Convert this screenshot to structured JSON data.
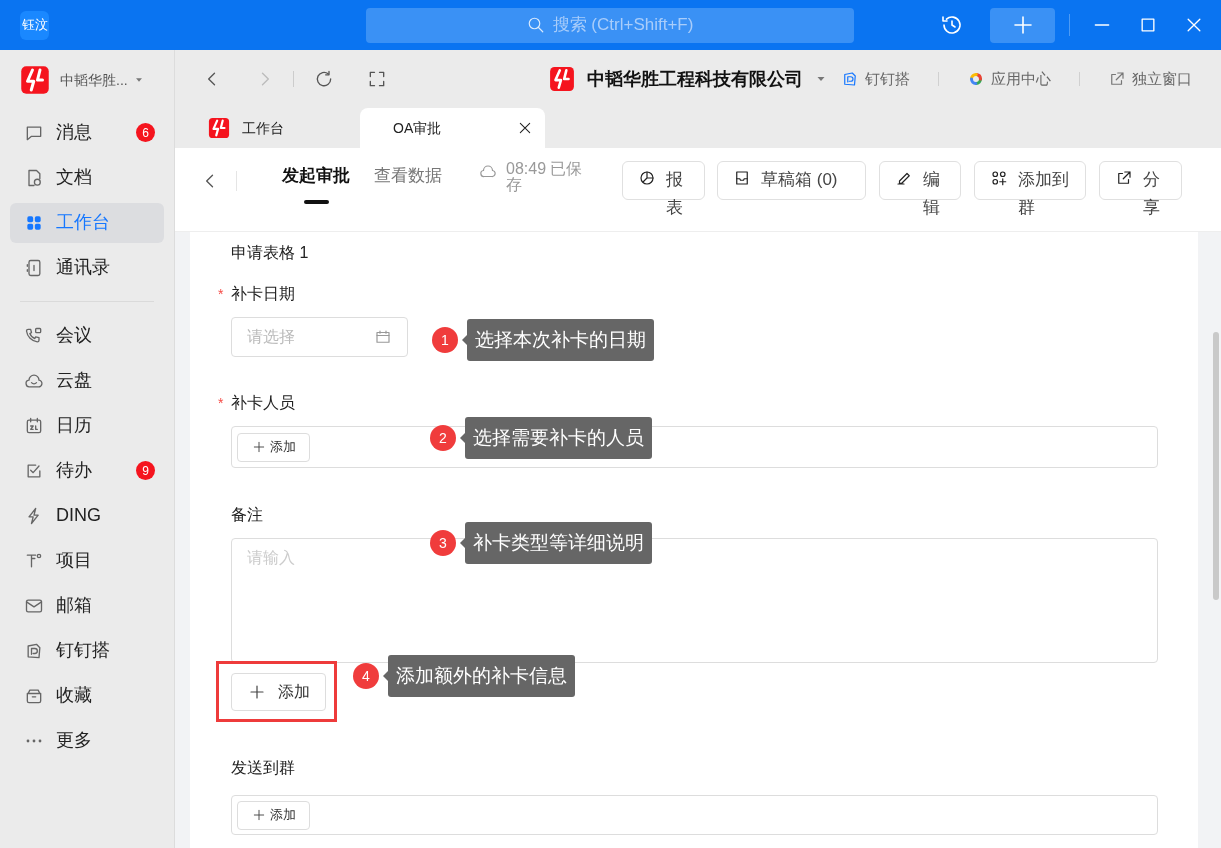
{
  "title_bar": {
    "app_badge": "钰汶",
    "search_placeholder": "搜索 (Ctrl+Shift+F)"
  },
  "sidebar": {
    "org": "中韬华胜...",
    "groups": [
      [
        {
          "label": "消息",
          "badge": "6",
          "selected": false
        },
        {
          "label": "文档",
          "selected": false
        },
        {
          "label": "工作台",
          "selected": true
        },
        {
          "label": "通讯录",
          "selected": false
        }
      ],
      [
        {
          "label": "会议",
          "selected": false
        },
        {
          "label": "云盘",
          "selected": false
        },
        {
          "label": "日历",
          "selected": false
        },
        {
          "label": "待办",
          "badge": "9",
          "selected": false
        },
        {
          "label": "DING",
          "selected": false
        },
        {
          "label": "项目",
          "selected": false
        },
        {
          "label": "邮箱",
          "selected": false
        },
        {
          "label": "钉钉搭",
          "selected": false
        },
        {
          "label": "收藏",
          "selected": false
        },
        {
          "label": "更多",
          "selected": false
        }
      ]
    ]
  },
  "toolbar": {
    "company": "中韬华胜工程科技有限公司",
    "links": [
      "钉钉搭",
      "应用中心",
      "独立窗口"
    ]
  },
  "page_tabs": [
    {
      "label": "工作台",
      "selected": false
    },
    {
      "label": "OA审批",
      "selected": true
    }
  ],
  "header": {
    "tabs": [
      {
        "label": "发起审批",
        "selected": true
      },
      {
        "label": "查看数据",
        "selected": false
      }
    ],
    "save_status": "08:49 已保存",
    "actions": [
      "报表",
      "草稿箱 (0)",
      "编辑",
      "添加到群",
      "分享"
    ]
  },
  "form": {
    "section_title": "申请表格 1",
    "required_mark": "*",
    "fields": [
      {
        "kind": "date",
        "label": "补卡日期",
        "required": true,
        "placeholder": "请选择"
      },
      {
        "kind": "people",
        "label": "补卡人员",
        "required": true,
        "button": "添加"
      },
      {
        "kind": "textarea",
        "label": "备注",
        "required": false,
        "placeholder": "请输入"
      }
    ],
    "add_button": "添加",
    "send_to_group": {
      "label": "发送到群",
      "button": "添加"
    }
  },
  "callouts": [
    {
      "number": "1",
      "text": "选择本次补卡的日期"
    },
    {
      "number": "2",
      "text": "选择需要补卡的人员"
    },
    {
      "number": "3",
      "text": "补卡类型等详细说明"
    },
    {
      "number": "4",
      "text": "添加额外的补卡信息"
    }
  ]
}
